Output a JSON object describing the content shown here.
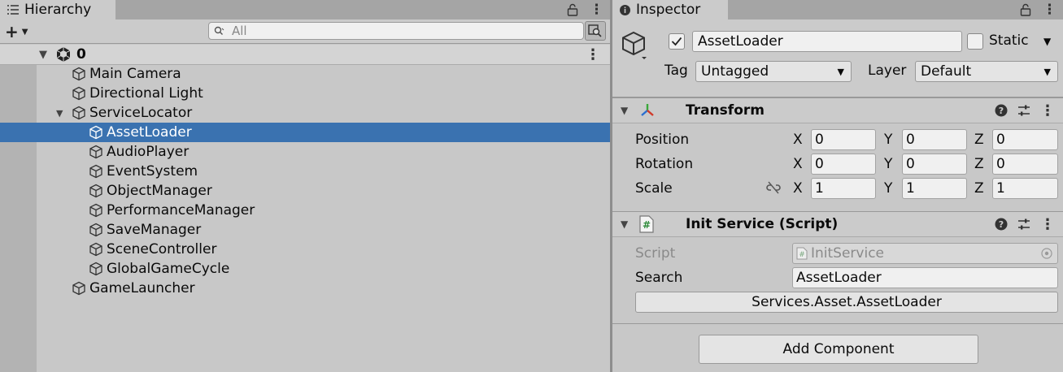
{
  "hierarchy": {
    "tab_label": "Hierarchy",
    "search_placeholder": "All",
    "scene_name": "0",
    "items": [
      {
        "label": "Main Camera",
        "depth": 1
      },
      {
        "label": "Directional Light",
        "depth": 1
      },
      {
        "label": "ServiceLocator",
        "depth": 1,
        "expanded": true
      },
      {
        "label": "AssetLoader",
        "depth": 2,
        "selected": true
      },
      {
        "label": "AudioPlayer",
        "depth": 2
      },
      {
        "label": "EventSystem",
        "depth": 2
      },
      {
        "label": "ObjectManager",
        "depth": 2
      },
      {
        "label": "PerformanceManager",
        "depth": 2
      },
      {
        "label": "SaveManager",
        "depth": 2
      },
      {
        "label": "SceneController",
        "depth": 2
      },
      {
        "label": "GlobalGameCycle",
        "depth": 2
      },
      {
        "label": "GameLauncher",
        "depth": 1
      }
    ]
  },
  "inspector": {
    "tab_label": "Inspector",
    "object_name": "AssetLoader",
    "static_label": "Static",
    "tag_label": "Tag",
    "tag_value": "Untagged",
    "layer_label": "Layer",
    "layer_value": "Default",
    "transform": {
      "title": "Transform",
      "position_label": "Position",
      "rotation_label": "Rotation",
      "scale_label": "Scale",
      "position": {
        "x": "0",
        "y": "0",
        "z": "0"
      },
      "rotation": {
        "x": "0",
        "y": "0",
        "z": "0"
      },
      "scale": {
        "x": "1",
        "y": "1",
        "z": "1"
      }
    },
    "axis": {
      "x": "X",
      "y": "Y",
      "z": "Z"
    },
    "script_component": {
      "title": "Init Service (Script)",
      "script_label": "Script",
      "script_value": "InitService",
      "search_label": "Search",
      "search_value": "AssetLoader",
      "result_button": "Services.Asset.AssetLoader"
    },
    "add_component": "Add Component"
  },
  "colors": {
    "selection": "#3a72b0",
    "panel": "#c8c8c8"
  }
}
